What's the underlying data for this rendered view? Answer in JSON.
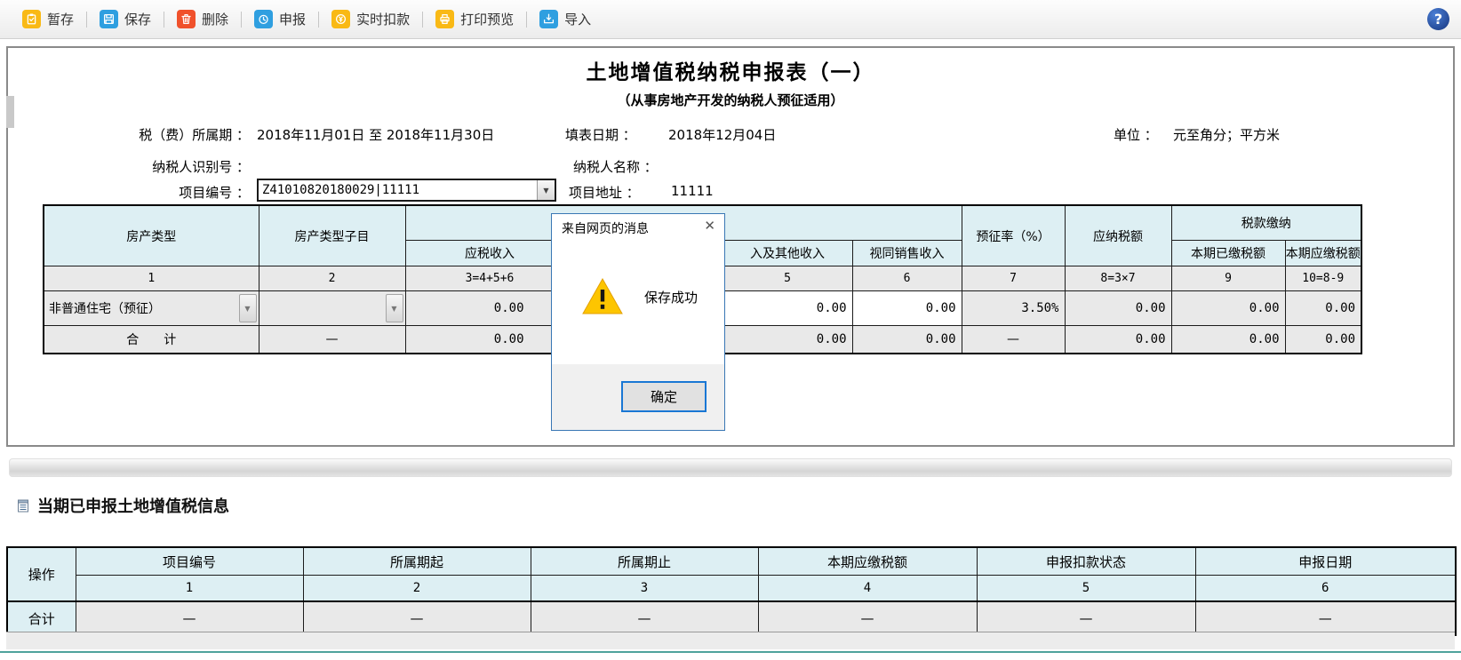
{
  "toolbar": {
    "buttons": [
      {
        "label": "暂存"
      },
      {
        "label": "保存"
      },
      {
        "label": "删除"
      },
      {
        "label": "申报"
      },
      {
        "label": "实时扣款"
      },
      {
        "label": "打印预览"
      },
      {
        "label": "导入"
      }
    ],
    "help": "?"
  },
  "colors": {
    "accent_yellow": "#f9b915",
    "accent_blue": "#2f9fe0",
    "accent_red": "#f0512b",
    "table_header_blue": "#ddeff3",
    "help_navy": "#16357e",
    "dialog_border": "#3977b4",
    "ok_button_border": "#1977d4",
    "bottom_accent_teal": "#4fa39c"
  },
  "form": {
    "title": "土地增值税纳税申报表（一）",
    "subtitle": "（从事房地产开发的纳税人预征适用）",
    "period_label": "税（费）所属期 ：",
    "period_value": "2018年11月01日 至 2018年11月30日",
    "fill_date_label": "填表日期 ：",
    "fill_date_value": "2018年12月04日",
    "unit_label": "单位 ：",
    "unit_value": "元至角分；平方米",
    "taxpayer_id_label": "纳税人识别号 ：",
    "taxpayer_id_value": "",
    "taxpayer_name_label": "纳税人名称 ：",
    "taxpayer_name_value": "",
    "project_no_label": "项目编号 ：",
    "project_no_value": "Z41010820180029|11111",
    "project_addr_label": "项目地址 ：",
    "project_addr_value": "11111"
  },
  "main_table": {
    "headers": {
      "c1": "房产类型",
      "c2": "房产类型子目",
      "group_income": "",
      "c3": "应税收入",
      "c4": "",
      "c5": "入及其他收入",
      "c6": "视同销售收入",
      "c7": "预征率（%）",
      "c8": "应纳税额",
      "group_tax": "税款缴纳",
      "c9": "本期已缴税额",
      "c10": "本期应缴税额"
    },
    "nums": [
      "1",
      "2",
      "3=4+5+6",
      "",
      "5",
      "6",
      "7",
      "8=3×7",
      "9",
      "10=8-9"
    ],
    "row": {
      "c1": "非普通住宅（预征）",
      "c2": "",
      "c3": "0.00",
      "c4": "",
      "c5": "0.00",
      "c6": "0.00",
      "c7": "3.50%",
      "c8": "0.00",
      "c9": "0.00",
      "c10": "0.00"
    },
    "total": {
      "c1": "合　　计",
      "c2": "—",
      "c3": "0.00",
      "c4": "",
      "c5": "0.00",
      "c6": "0.00",
      "c7": "—",
      "c8": "0.00",
      "c9": "0.00",
      "c10": "0.00"
    }
  },
  "dialog": {
    "title": "来自网页的消息",
    "close": "✕",
    "message": "保存成功",
    "ok": "确定"
  },
  "section2": {
    "title": "当期已申报土地增值税信息"
  },
  "declared_table": {
    "headers": {
      "op": "操作",
      "c1": "项目编号",
      "c2": "所属期起",
      "c3": "所属期止",
      "c4": "本期应缴税额",
      "c5": "申报扣款状态",
      "c6": "申报日期"
    },
    "nums": [
      "1",
      "2",
      "3",
      "4",
      "5",
      "6"
    ],
    "total_label": "合计",
    "total_values": [
      "—",
      "—",
      "—",
      "—",
      "—",
      "—"
    ]
  }
}
